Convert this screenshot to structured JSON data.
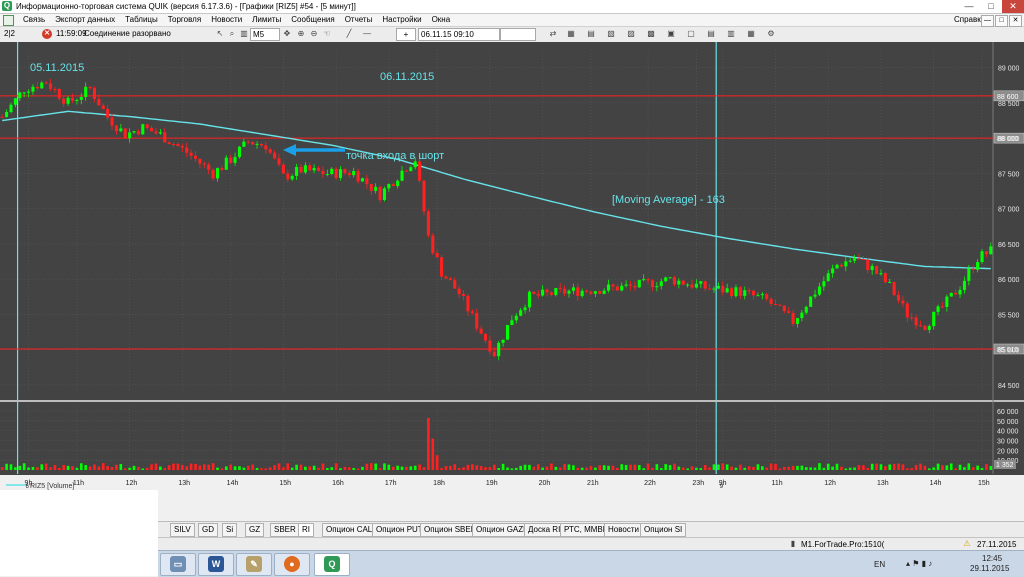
{
  "window": {
    "title": "Информационно-торговая система QUIK (версия 6.17.3.6) - [Графики [RIZ5] #54 - [5 минут]]",
    "icon_letter": "Q",
    "minimize": "—",
    "maximize": "□",
    "close": "✕"
  },
  "menu": {
    "items": [
      "Связь",
      "Экспорт данных",
      "Таблицы",
      "Торговля",
      "Новости",
      "Лимиты",
      "Сообщения",
      "Отчеты",
      "Настройки",
      "Окна"
    ],
    "help": "Справка"
  },
  "toolbar": {
    "counter": "2|2",
    "time": "11:59:09",
    "connection_status": "Соединение разорвано",
    "interval": "M5",
    "datetime": "06.11.15 09:10",
    "plus": "+"
  },
  "chart_data": {
    "type": "candlestick",
    "instrument": "RIZ5",
    "interval": "5 минут",
    "ylim": [
      84400,
      89250
    ],
    "y_ticks": [
      84500,
      85000,
      85500,
      86000,
      86500,
      87000,
      87500,
      88000,
      88500,
      89000
    ],
    "y_tick_labels": [
      "84 500",
      "85 000",
      "85 500",
      "86 000",
      "86 500",
      "87 000",
      "87 500",
      "88 000",
      "88 500",
      "89 000"
    ],
    "x_ticks": [
      "9h",
      "11h",
      "12h",
      "13h",
      "14h",
      "15h",
      "16h",
      "17h",
      "18h",
      "19h",
      "20h",
      "21h",
      "22h",
      "23h",
      "9h",
      "11h",
      "12h",
      "13h",
      "14h",
      "15h"
    ],
    "day_marks": [
      "6",
      "9"
    ],
    "horizontal_levels": [
      88600,
      88000,
      85010
    ],
    "level_labels": [
      "88 600",
      "88 000",
      "85 010"
    ],
    "annotations": {
      "date_1": "05.11.2015",
      "date_2": "06.11.2015",
      "entry": "точка входа в шорт",
      "ma_label": "[Moving Average] - 163"
    },
    "price_path": [
      [
        0,
        88300
      ],
      [
        5,
        88700
      ],
      [
        10,
        88800
      ],
      [
        15,
        88500
      ],
      [
        20,
        88700
      ],
      [
        24,
        88300
      ],
      [
        28,
        88050
      ],
      [
        32,
        88150
      ],
      [
        36,
        88050
      ],
      [
        42,
        87800
      ],
      [
        48,
        87500
      ],
      [
        52,
        87700
      ],
      [
        56,
        87950
      ],
      [
        60,
        87900
      ],
      [
        64,
        87450
      ],
      [
        68,
        87550
      ],
      [
        74,
        87500
      ],
      [
        80,
        87520
      ],
      [
        86,
        87200
      ],
      [
        92,
        87600
      ],
      [
        94,
        87700
      ],
      [
        97,
        86600
      ],
      [
        100,
        86100
      ],
      [
        104,
        85800
      ],
      [
        108,
        85350
      ],
      [
        112,
        84950
      ],
      [
        116,
        85450
      ],
      [
        120,
        85750
      ],
      [
        128,
        85820
      ],
      [
        136,
        85860
      ],
      [
        144,
        85900
      ],
      [
        152,
        86000
      ],
      [
        160,
        85880
      ],
      [
        168,
        85820
      ],
      [
        174,
        85700
      ],
      [
        180,
        85400
      ],
      [
        186,
        85900
      ],
      [
        190,
        86200
      ],
      [
        194,
        86300
      ],
      [
        198,
        86150
      ],
      [
        202,
        85900
      ],
      [
        206,
        85500
      ],
      [
        210,
        85350
      ],
      [
        214,
        85600
      ],
      [
        218,
        85900
      ],
      [
        222,
        86300
      ],
      [
        225,
        86400
      ]
    ],
    "moving_average": {
      "period": 163,
      "points": [
        [
          0,
          88250
        ],
        [
          15,
          88380
        ],
        [
          30,
          88300
        ],
        [
          45,
          88200
        ],
        [
          60,
          88050
        ],
        [
          75,
          87900
        ],
        [
          90,
          87700
        ],
        [
          105,
          87420
        ],
        [
          120,
          87180
        ],
        [
          135,
          86950
        ],
        [
          150,
          86750
        ],
        [
          165,
          86580
        ],
        [
          180,
          86430
        ],
        [
          195,
          86300
        ],
        [
          210,
          86180
        ],
        [
          225,
          86150
        ]
      ]
    },
    "volume": {
      "label": "RIZ5 [Volume]",
      "ylim": [
        0,
        65000
      ],
      "y_ticks": [
        10000,
        20000,
        30000,
        40000,
        50000,
        60000
      ],
      "y_tick_labels": [
        "10 000",
        "20 000",
        "30 000",
        "40 000",
        "50 000",
        "60 000"
      ],
      "last_value_label": "1 352",
      "spikes": [
        [
          97,
          53000
        ],
        [
          98,
          32000
        ],
        [
          99,
          15000
        ]
      ]
    },
    "colors": {
      "background": "#434343",
      "up": "#00ff00",
      "down": "#ff2020",
      "ma": "#66e3e9",
      "level": "#ff1e1e",
      "annotation": "#66e3e9",
      "arrow": "#1aa0e8",
      "grid": "#5a5a5a"
    }
  },
  "tabs": {
    "items": [
      "SILV",
      "GD",
      "Si",
      "GZ",
      "SBER",
      "RI",
      "Опцион CALL",
      "Опцион PUT",
      "Опцион SBER",
      "Опцион GAZP",
      "Доска RI",
      "РТС, ММВБ",
      "Новости",
      "Опцион SI"
    ],
    "active": "RI"
  },
  "status": {
    "account": "M1.ForTrade.Pro:1510(",
    "date": "27.11.2015"
  },
  "taskbar": {
    "lang": "EN",
    "time": "12:45",
    "date": "29.11.2015",
    "app_labels": [
      "W",
      "Q"
    ]
  }
}
